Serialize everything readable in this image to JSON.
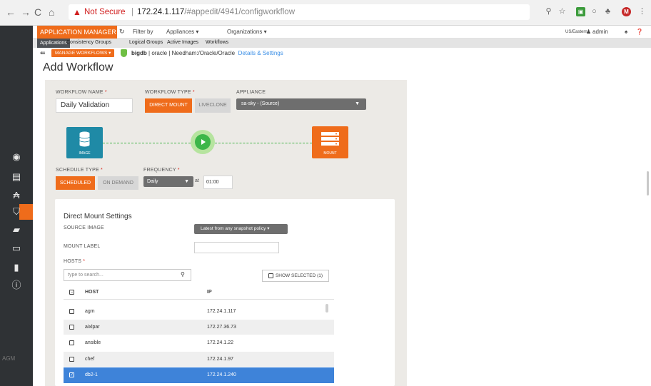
{
  "browser": {
    "not_secure": "Not Secure",
    "host": "172.24.1.117",
    "path": "/#appedit/4941/configworkflow",
    "profile_initial": "M"
  },
  "appbar": {
    "app_name": "APPLICATION MANAGER",
    "filter_by": "Filter by",
    "appliances": "Appliances ▾",
    "organizations": "Organizations ▾",
    "timezone": "US/Eastern",
    "user": "admin"
  },
  "subnav": {
    "items": [
      "Applications",
      "Consistency Groups",
      "Logical Groups",
      "Active Images",
      "Workflows"
    ]
  },
  "breadcrumb": {
    "manage_workflows": "MANAGE WORKFLOWS",
    "app": "bigdb",
    "db_type": "| oracle |",
    "path": "Needham:/Oracle/Oracle",
    "details_link": "Details & Settings"
  },
  "page": {
    "title": "Add Workflow"
  },
  "form": {
    "workflow_name_label": "WORKFLOW NAME",
    "workflow_name_value": "Daily Validation",
    "workflow_type_label": "WORKFLOW TYPE",
    "type_direct_mount": "DIRECT MOUNT",
    "type_liveclone": "LIVECLONE",
    "appliance_label": "APPLIANCE",
    "appliance_value": "sa-sky - (Source)",
    "node_image": "IMAGE",
    "node_mount": "MOUNT",
    "schedule_type_label": "SCHEDULE TYPE",
    "schedule_scheduled": "SCHEDULED",
    "schedule_on_demand": "ON DEMAND",
    "frequency_label": "FREQUENCY",
    "frequency_value": "Daily",
    "at_label": "at",
    "time_value": "01:00",
    "req": "*"
  },
  "mount_settings": {
    "title": "Direct Mount Settings",
    "source_image_label": "SOURCE IMAGE",
    "source_image_value": "Latest from any snapshot policy ▾",
    "mount_label_label": "MOUNT LABEL",
    "hosts_label": "HOSTS",
    "search_placeholder": "type to search...",
    "show_selected": "SHOW SELECTED (1)",
    "col_host": "HOST",
    "col_ip": "IP",
    "rows": [
      {
        "host": "agm",
        "ip": "172.24.1.117"
      },
      {
        "host": "aixlpar",
        "ip": "172.27.36.73"
      },
      {
        "host": "ansible",
        "ip": "172.24.1.22"
      },
      {
        "host": "chef",
        "ip": "172.24.1.97"
      },
      {
        "host": "db2-1",
        "ip": "172.24.1.240"
      }
    ]
  },
  "sidebar": {
    "footer": "AGM"
  }
}
